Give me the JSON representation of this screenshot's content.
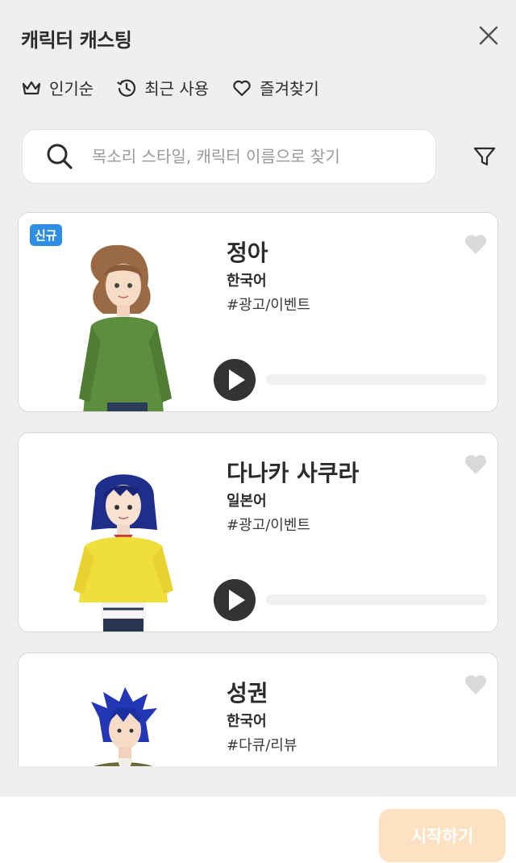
{
  "header": {
    "title": "캐릭터 캐스팅",
    "close_icon": "close-icon"
  },
  "tabs": [
    {
      "label": "인기순",
      "icon": "crown-icon"
    },
    {
      "label": "최근 사용",
      "icon": "history-icon"
    },
    {
      "label": "즐겨찾기",
      "icon": "heart-outline-icon"
    }
  ],
  "search": {
    "placeholder": "목소리 스타일, 캐릭터 이름으로 찾기",
    "value": ""
  },
  "characters": [
    {
      "name": "정아",
      "language": "한국어",
      "tag": "#광고/이벤트",
      "badge": "신규",
      "favorited": false,
      "progress": 0
    },
    {
      "name": "다나카 사쿠라",
      "language": "일본어",
      "tag": "#광고/이벤트",
      "badge": "",
      "favorited": false,
      "progress": 0
    },
    {
      "name": "성권",
      "language": "한국어",
      "tag": "#다큐/리뷰",
      "badge": "",
      "favorited": false,
      "progress": 0
    }
  ],
  "footer": {
    "start_label": "시작하기"
  },
  "colors": {
    "background": "#efefef",
    "badge": "#2f8de4",
    "start_button": "#fde1c3",
    "play_button": "#333333",
    "heart": "#d9d9d9"
  }
}
